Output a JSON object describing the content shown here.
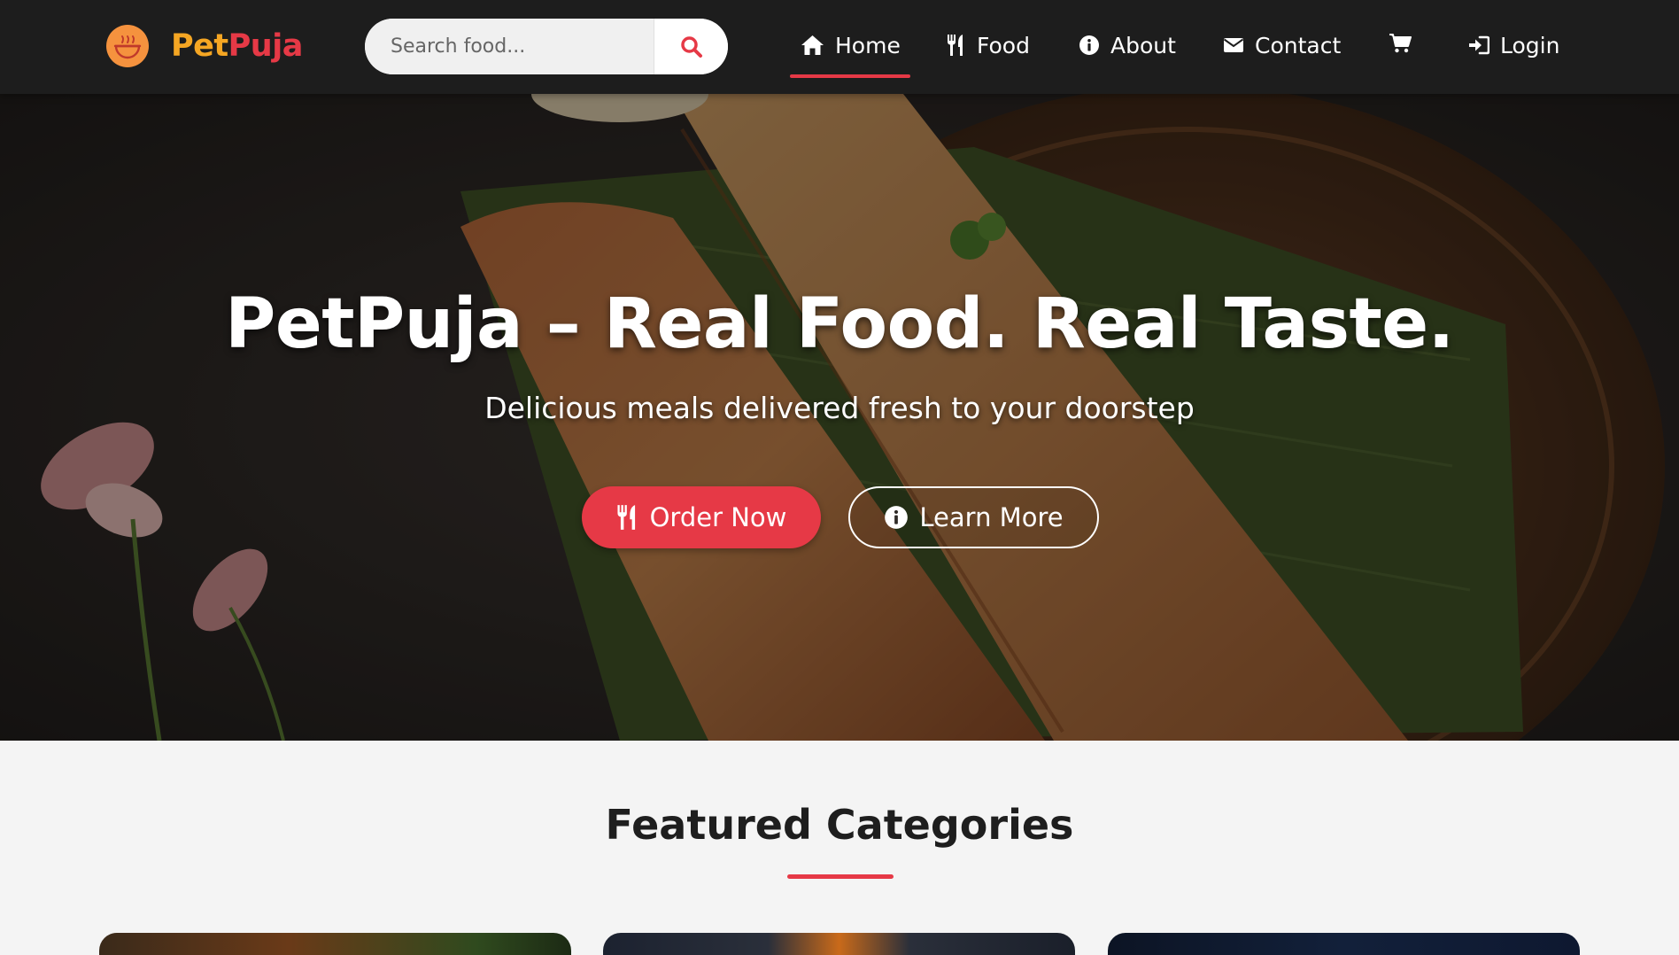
{
  "brand": {
    "name_part1": "Pet",
    "name_part2": "Puja",
    "accent_color": "#e63946",
    "secondary_color": "#f5a623",
    "logo_icon": "food-bowl-icon"
  },
  "search": {
    "placeholder": "Search food...",
    "icon": "search-icon"
  },
  "nav": {
    "items": [
      {
        "label": "Home",
        "icon": "home-icon",
        "active": true
      },
      {
        "label": "Food",
        "icon": "utensils-icon",
        "active": false
      },
      {
        "label": "About",
        "icon": "info-icon",
        "active": false
      },
      {
        "label": "Contact",
        "icon": "envelope-icon",
        "active": false
      }
    ],
    "cart_icon": "cart-icon",
    "login_label": "Login",
    "login_icon": "sign-in-icon"
  },
  "hero": {
    "title": "PetPuja – Real Food. Real Taste.",
    "subtitle": "Delicious meals delivered fresh to your doorstep",
    "primary_button": "Order Now",
    "secondary_button": "Learn More"
  },
  "featured": {
    "title": "Featured Categories"
  }
}
